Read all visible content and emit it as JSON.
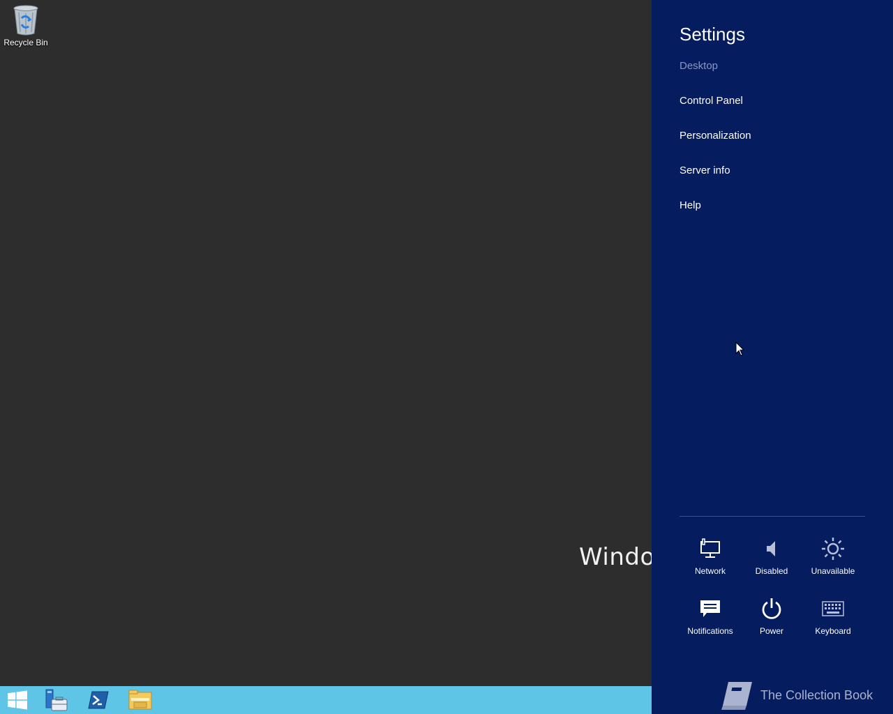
{
  "desktop": {
    "recycle_bin_label": "Recycle Bin",
    "watermark_text": "Windows"
  },
  "taskbar": {
    "items": [
      {
        "icon": "windows-start-icon"
      },
      {
        "icon": "server-manager-icon"
      },
      {
        "icon": "powershell-icon"
      },
      {
        "icon": "file-explorer-icon"
      }
    ],
    "color": "#5fc5e6"
  },
  "settings": {
    "title": "Settings",
    "context": "Desktop",
    "menu": [
      "Control Panel",
      "Personalization",
      "Server info",
      "Help"
    ],
    "tiles": [
      {
        "label": "Network",
        "icon": "network-icon"
      },
      {
        "label": "Disabled",
        "icon": "volume-icon"
      },
      {
        "label": "Unavailable",
        "icon": "brightness-icon"
      },
      {
        "label": "Notifications",
        "icon": "notifications-icon"
      },
      {
        "label": "Power",
        "icon": "power-icon"
      },
      {
        "label": "Keyboard",
        "icon": "keyboard-icon"
      }
    ],
    "background": "#051c5e"
  },
  "branding": {
    "text": "The Collection Book"
  }
}
